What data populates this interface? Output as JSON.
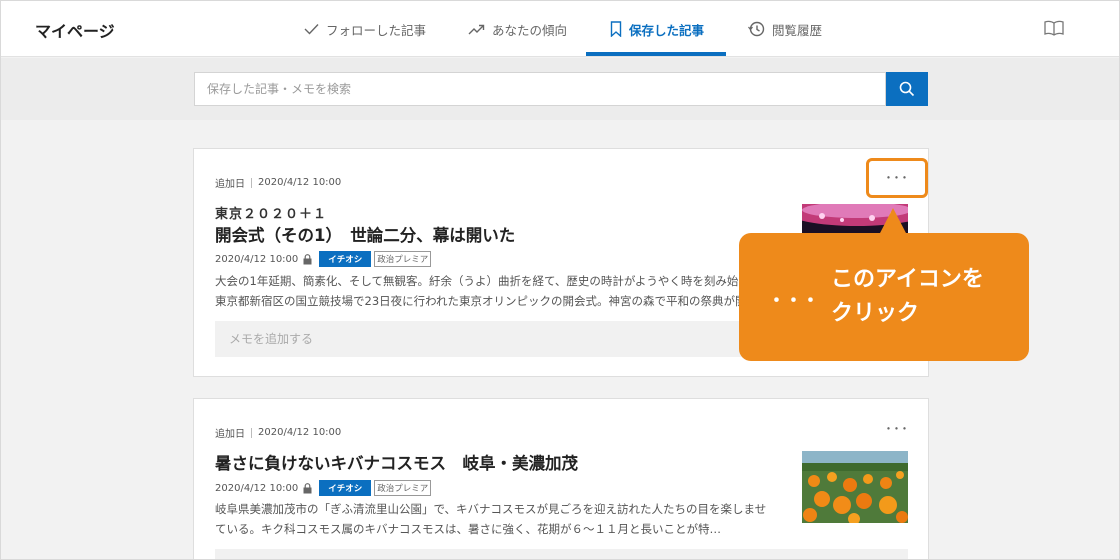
{
  "header": {
    "brand": "マイページ",
    "tabs": [
      {
        "label": "フォローした記事",
        "icon": "check-icon"
      },
      {
        "label": "あなたの傾向",
        "icon": "trend-icon"
      },
      {
        "label": "保存した記事",
        "icon": "bookmark-icon",
        "active": true
      },
      {
        "label": "閲覧履歴",
        "icon": "history-icon"
      }
    ],
    "right_icon": "book-icon"
  },
  "search": {
    "placeholder": "保存した記事・メモを検索",
    "button_icon": "search-icon"
  },
  "colors": {
    "accent": "#0b6fc0",
    "callout": "#ee8a1b"
  },
  "articles": [
    {
      "added_label": "追加日",
      "added_date": "2020/4/12 10:00",
      "kicker": "東京２０２０＋１",
      "title": "開会式（その1）　世論二分、幕は開いた",
      "date": "2020/4/12 10:00",
      "badge": "イチオシ",
      "tag": "政治プレミア",
      "excerpt": "大会の1年延期、簡素化、そして無観客。紆余（うよ）曲折を経て、歴史の時計がようやく時を刻み始めた。東京都新宿区の国立競技場で23日夜に行われた東京オリンピックの開会式。神宮の森で平和の祭典が開幕した。",
      "memo_placeholder": "メモを追加する",
      "more": "･･･"
    },
    {
      "added_label": "追加日",
      "added_date": "2020/4/12 10:00",
      "title": "暑さに負けないキバナコスモス　岐阜・美濃加茂",
      "date": "2020/4/12 10:00",
      "badge": "イチオシ",
      "tag": "政治プレミア",
      "excerpt": "岐阜県美濃加茂市の「ぎふ清流里山公園」で、キバナコスモスが見ごろを迎え訪れた人たちの目を楽しませている。キク科コスモス属のキバナコスモスは、暑さに強く、花期が６～１１月と長いことが特…",
      "more": "･･･"
    }
  ],
  "callout": {
    "dots": "･･･",
    "line1": "このアイコンを",
    "line2": "クリック"
  }
}
